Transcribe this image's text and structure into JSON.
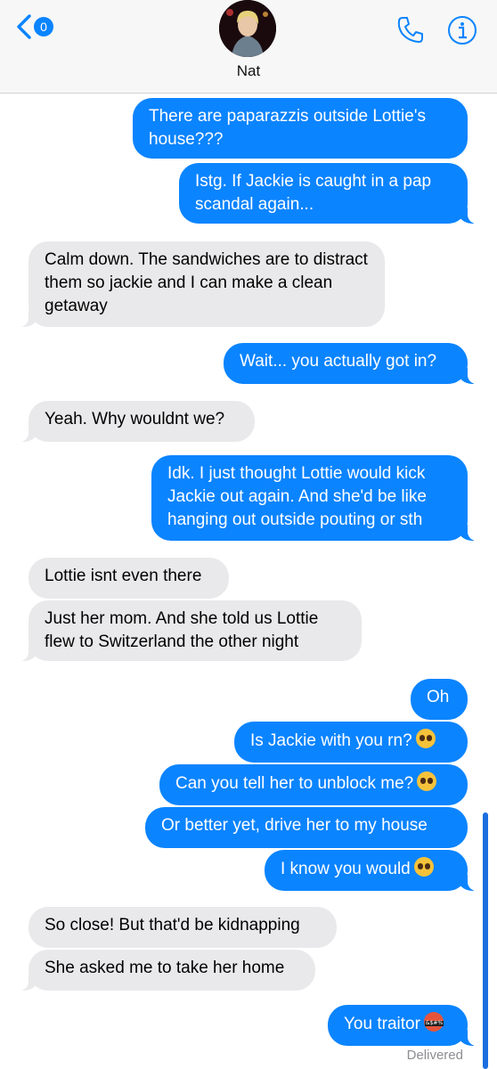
{
  "header": {
    "back_badge": "0",
    "contact_name": "Nat",
    "icons": {
      "back": "chevron-left-icon",
      "phone": "phone-icon",
      "info": "info-icon"
    },
    "background": "#f7f7f7"
  },
  "colors": {
    "sent_bubble": "#0b84ff",
    "received_bubble": "#e9e9eb",
    "accent": "#0b84ff"
  },
  "messages": [
    {
      "from": "me",
      "text": "There are paparazzis outside Lottie's house???"
    },
    {
      "from": "me",
      "text": "Istg. If Jackie is caught in a pap scandal again..."
    },
    {
      "from": "them",
      "text": "Calm down. The sandwiches are to distract them so jackie and I can make a clean getaway"
    },
    {
      "from": "me",
      "text": "Wait... you actually got in?"
    },
    {
      "from": "them",
      "text": "Yeah. Why wouldnt we?"
    },
    {
      "from": "me",
      "text": "Idk. I just thought Lottie would kick Jackie out again. And she'd be like hanging out outside pouting or sth"
    },
    {
      "from": "them",
      "text": "Lottie isnt even there"
    },
    {
      "from": "them",
      "text": "Just her mom. And she told us Lottie flew to Switzerland the other night"
    },
    {
      "from": "me",
      "text": "Oh"
    },
    {
      "from": "me",
      "text": "Is Jackie with you rn?",
      "emoji": "pleading-face"
    },
    {
      "from": "me",
      "text": "Can you tell her to unblock me?",
      "emoji": "pleading-face"
    },
    {
      "from": "me",
      "text": "Or better yet, drive her to my house"
    },
    {
      "from": "me",
      "text": "I know you would",
      "emoji": "pleading-face"
    },
    {
      "from": "them",
      "text": "So close! But that'd be kidnapping"
    },
    {
      "from": "them",
      "text": "She asked me to take her home"
    },
    {
      "from": "me",
      "text": "You traitor",
      "emoji": "cursing-face"
    }
  ],
  "status": {
    "delivered": "Delivered"
  }
}
